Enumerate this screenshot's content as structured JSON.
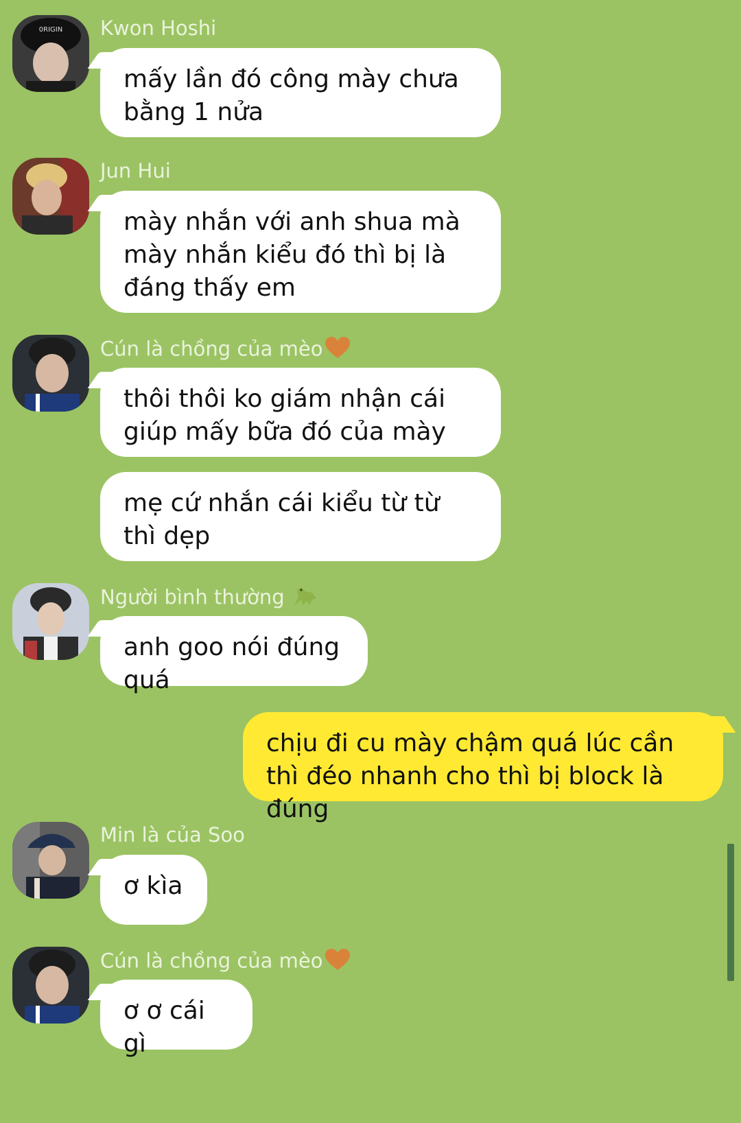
{
  "colors": {
    "background": "#9bc363",
    "incoming_bubble": "#ffffff",
    "outgoing_bubble": "#ffe933",
    "sender_name": "#eaf3dc"
  },
  "messages": [
    {
      "sender": "Kwon Hoshi",
      "text": "mấy lần đó công mày chưa bằng 1 nửa"
    },
    {
      "sender": "Jun Hui",
      "text": "mày nhắn với anh shua mà mày nhắn kiểu đó thì bị là đáng thấy em"
    },
    {
      "sender": "Cún là chồng của mèo",
      "sender_emoji": "orange-heart-icon",
      "texts": [
        "thôi thôi ko giám nhận cái giúp mấy bữa đó của mày",
        "mẹ cứ nhắn cái kiểu từ từ thì dẹp"
      ]
    },
    {
      "sender": "Người bình thường",
      "sender_emoji": "dinosaur-icon",
      "text": "anh goo nói đúng quá"
    },
    {
      "sender": "",
      "outgoing": true,
      "text": "chịu đi cu mày chậm quá lúc cần thì đéo nhanh cho thì bị block là đúng"
    },
    {
      "sender": "Min là của Soo",
      "text": "ơ kìa"
    },
    {
      "sender": "Cún là chồng của mèo",
      "sender_emoji": "orange-heart-icon",
      "text": "ơ ơ cái gì"
    }
  ]
}
